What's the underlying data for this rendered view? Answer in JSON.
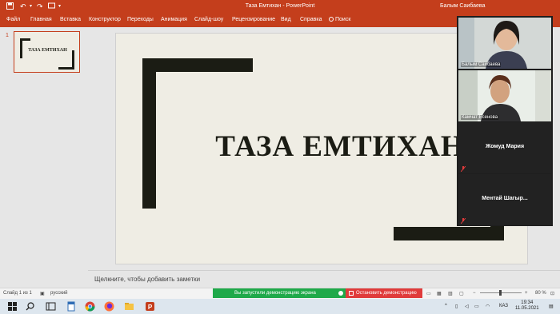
{
  "app": {
    "document_title": "Таза Емтихан  -  PowerPoint",
    "user_name": "Балым Саибаева"
  },
  "ribbon": {
    "tabs": [
      "Файл",
      "Главная",
      "Вставка",
      "Конструктор",
      "Переходы",
      "Анимация",
      "Слайд-шоу",
      "Рецензирование",
      "Вид",
      "Справка"
    ],
    "search_label": "Поиск"
  },
  "thumbnails": [
    {
      "number": "1",
      "title": "ТАЗА ЕМТИХАН"
    }
  ],
  "slide": {
    "title": "ТАЗА ЕМТИХАН",
    "background_color": "#efede4",
    "accent_color": "#1b1c14"
  },
  "notes": {
    "placeholder": "Щелкните, чтобы добавить заметки"
  },
  "status_bar": {
    "slide_info": "Слайд 1 из 1",
    "language": "русский",
    "share_started": "Вы запустили демонстрацию экрана",
    "stop_share": "Остановить демонстрацию",
    "zoom": "80 %",
    "zoom_level_percent": 80
  },
  "video_panel": {
    "participants": [
      {
        "name": "Балым Саибаева",
        "video": true
      },
      {
        "name": "Камчат Есенова",
        "video": true
      },
      {
        "name": "Жомуд Мария",
        "video": false,
        "muted": true
      },
      {
        "name": "Ментай  Шагыр...",
        "video": false,
        "muted": true
      }
    ]
  },
  "taskbar": {
    "apps": [
      "windows-icon",
      "search-icon",
      "task-view-icon",
      "file-icon",
      "chrome-icon",
      "firefox-icon",
      "file-explorer-icon",
      "powerpoint-icon"
    ],
    "language": "КАЗ",
    "time": "19:34",
    "date": "11.05.2021"
  },
  "colors": {
    "powerpoint_brand": "#c43e1c",
    "share_green": "#1fa94a",
    "stop_red": "#e03b3b"
  }
}
